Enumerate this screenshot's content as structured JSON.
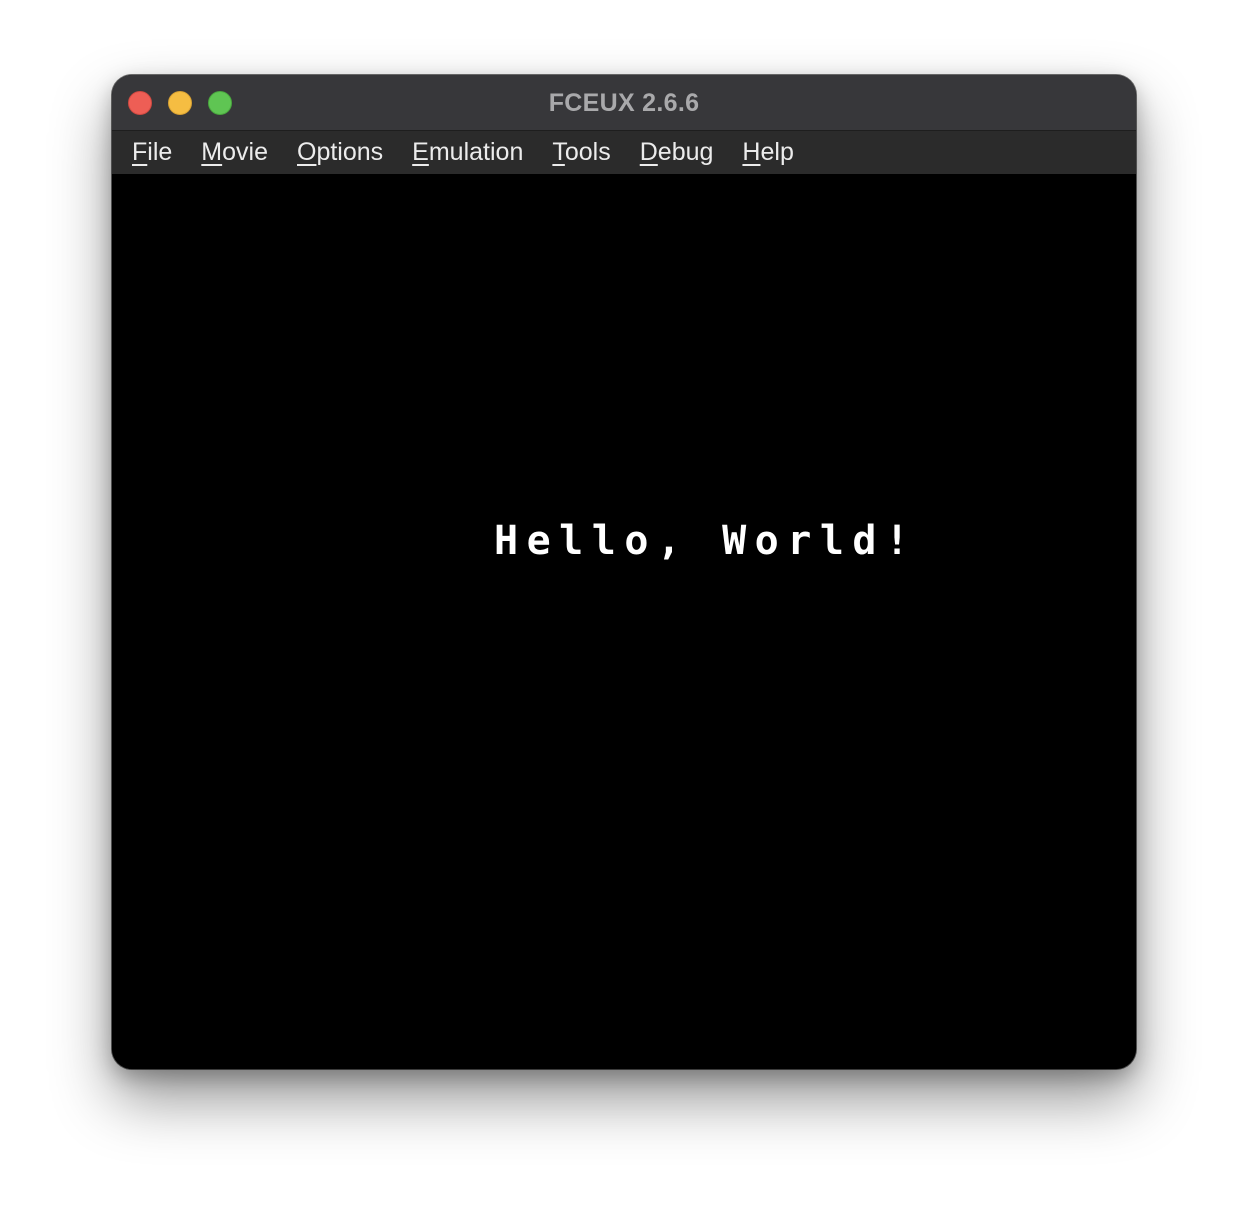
{
  "window": {
    "title": "FCEUX 2.6.6"
  },
  "menubar": {
    "items": [
      {
        "label": "File",
        "mnemonic": "F",
        "rest": "ile"
      },
      {
        "label": "Movie",
        "mnemonic": "M",
        "rest": "ovie"
      },
      {
        "label": "Options",
        "mnemonic": "O",
        "rest": "ptions"
      },
      {
        "label": "Emulation",
        "mnemonic": "E",
        "rest": "mulation"
      },
      {
        "label": "Tools",
        "mnemonic": "T",
        "rest": "ools"
      },
      {
        "label": "Debug",
        "mnemonic": "D",
        "rest": "ebug"
      },
      {
        "label": "Help",
        "mnemonic": "H",
        "rest": "elp"
      }
    ]
  },
  "screen": {
    "text": "Hello, World!"
  },
  "colors": {
    "close": "#ee5e55",
    "minimize": "#f5bd42",
    "zoom": "#5fc553",
    "titlebar": "#37373a",
    "menubar": "#2b2b2b",
    "screen_bg": "#000000",
    "screen_text": "#ffffff"
  }
}
